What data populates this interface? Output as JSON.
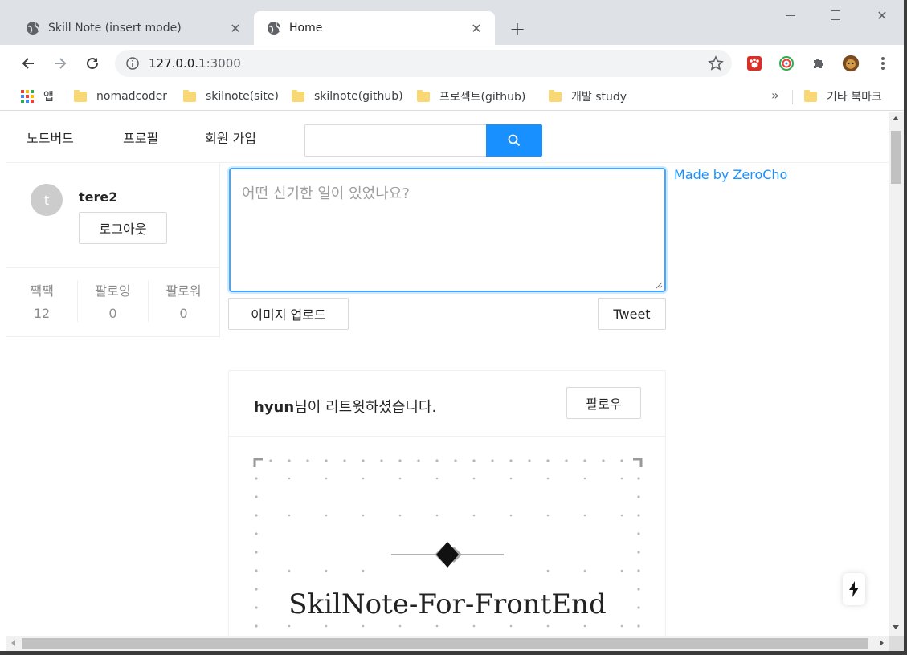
{
  "browser": {
    "tabs": [
      {
        "title": "Skill Note (insert mode)",
        "active": false
      },
      {
        "title": "Home",
        "active": true
      }
    ],
    "address_host": "127.0.0.1",
    "address_port": ":3000",
    "bookmarks": [
      {
        "label": "앱",
        "icon": "apps-grid-icon"
      },
      {
        "label": "nomadcoder",
        "icon": "folder-icon"
      },
      {
        "label": "skilnote(site)",
        "icon": "folder-icon"
      },
      {
        "label": "skilnote(github)",
        "icon": "folder-icon"
      },
      {
        "label": "프로젝트(github)",
        "icon": "folder-icon"
      },
      {
        "label": "개발 study",
        "icon": "folder-icon"
      }
    ],
    "bookmarks_more": "»",
    "other_bookmarks": "기타 북마크"
  },
  "nav": {
    "items": [
      "노드버드",
      "프로필",
      "회원 가입"
    ],
    "search_placeholder": ""
  },
  "profile": {
    "avatar_letter": "t",
    "nickname": "tere2",
    "logout": "로그아웃",
    "stats": [
      {
        "label": "짹짹",
        "value": "12"
      },
      {
        "label": "팔로잉",
        "value": "0"
      },
      {
        "label": "팔로워",
        "value": "0"
      }
    ]
  },
  "composer": {
    "placeholder": "어떤 신기한 일이 있었나요?",
    "upload": "이미지 업로드",
    "tweet": "Tweet"
  },
  "side_link": "Made by ZeroCho",
  "post": {
    "author": "hyun",
    "retweet_suffix": "님이 리트윗하셨습니다.",
    "follow": "팔로우",
    "image_text": "SkilNote-For-FrontEnd"
  },
  "colors": {
    "primary": "#1890ff",
    "focus_border": "#40a9ff",
    "chrome_bg": "#dee1e6"
  }
}
